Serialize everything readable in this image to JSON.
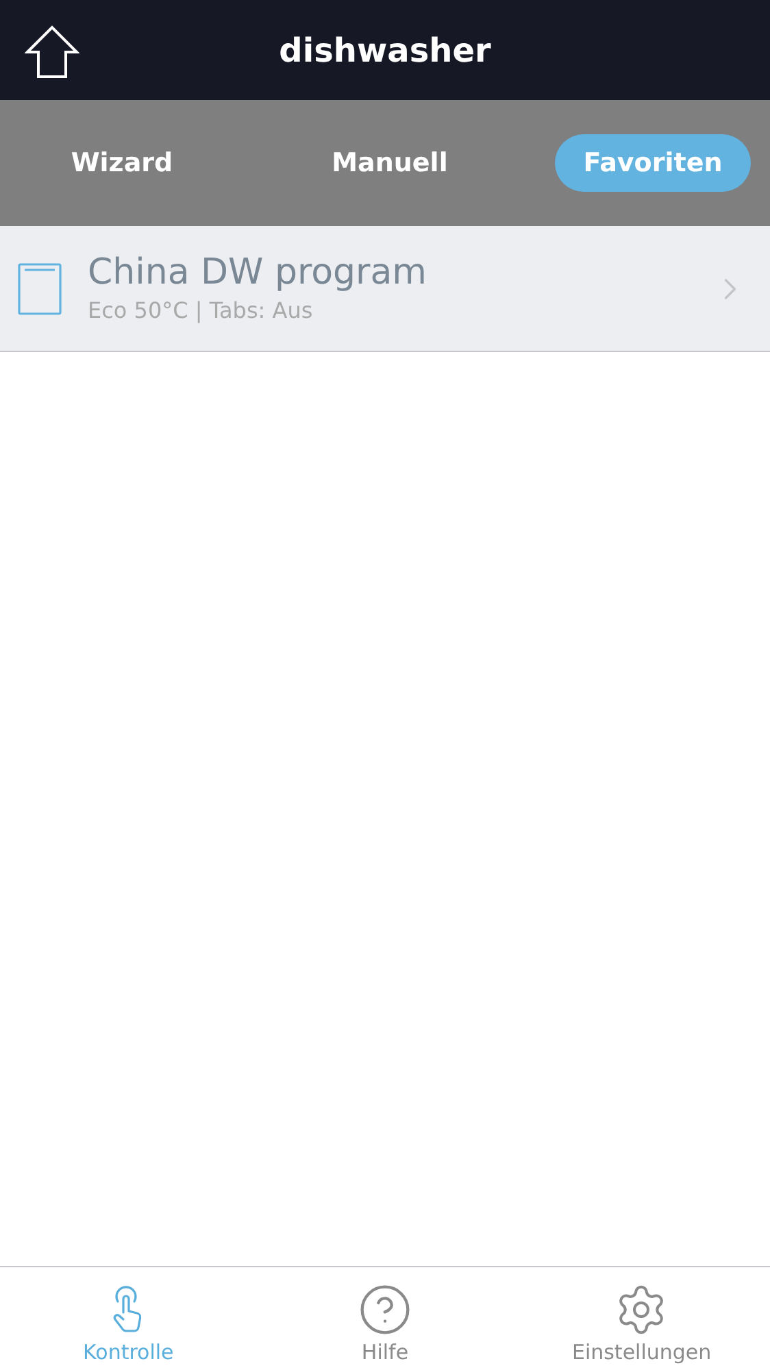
{
  "header": {
    "title": "dishwasher"
  },
  "tabs": [
    {
      "label": "Wizard",
      "selected": false
    },
    {
      "label": "Manuell",
      "selected": false
    },
    {
      "label": "Favoriten",
      "selected": true
    }
  ],
  "favorites": [
    {
      "title": "China DW program",
      "subtitle": "Eco 50°C | Tabs: Aus"
    }
  ],
  "bottom_nav": [
    {
      "kind": "touch",
      "label": "Kontrolle",
      "selected": true
    },
    {
      "kind": "help",
      "label": "Hilfe",
      "selected": false
    },
    {
      "kind": "settings",
      "label": "Einstellungen",
      "selected": false
    }
  ]
}
